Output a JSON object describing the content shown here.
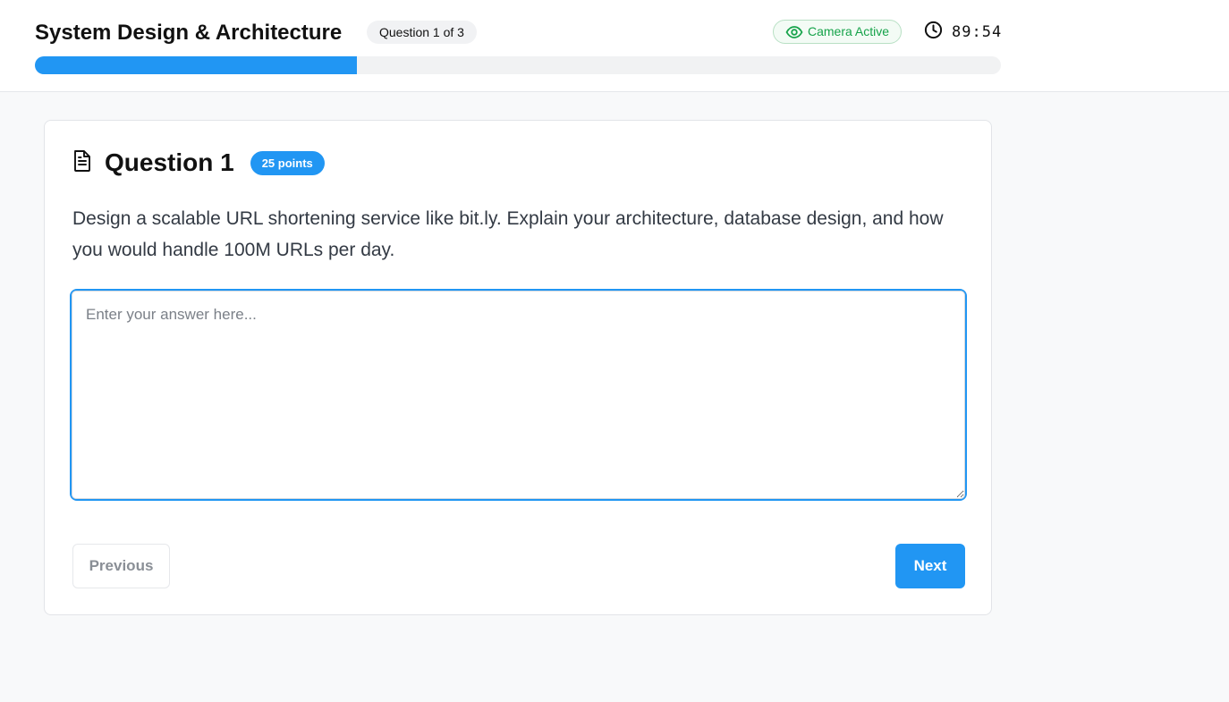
{
  "header": {
    "title": "System Design & Architecture",
    "question_counter": "Question 1 of 3",
    "camera_status": "Camera Active",
    "timer": "89:54",
    "progress_fraction": 0.333
  },
  "question": {
    "title": "Question 1",
    "points": "25 points",
    "text": "Design a scalable URL shortening service like bit.ly. Explain your architecture, database design, and how you would handle 100M URLs per day.",
    "answer_placeholder": "Enter your answer here...",
    "answer_value": ""
  },
  "navigation": {
    "previous_label": "Previous",
    "next_label": "Next"
  },
  "colors": {
    "accent": "#2196f3",
    "camera_green": "#16a34a"
  },
  "icons": {
    "camera": "eye-icon",
    "timer": "clock-icon",
    "question": "document-icon"
  }
}
